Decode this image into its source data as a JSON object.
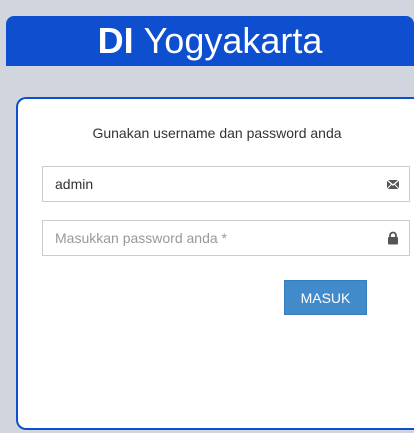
{
  "header": {
    "title_bold": "DI",
    "title_rest": "Yogyakarta"
  },
  "form": {
    "instruction": "Gunakan username dan password anda",
    "username": {
      "value": "admin",
      "placeholder": "",
      "icon": "envelope-icon"
    },
    "password": {
      "value": "",
      "placeholder": "Masukkan password anda *",
      "icon": "lock-icon"
    },
    "submit_label": "MASUK"
  },
  "colors": {
    "header_bg": "#0d4fcf",
    "page_bg": "#d1d5de",
    "button_bg": "#428bca"
  }
}
